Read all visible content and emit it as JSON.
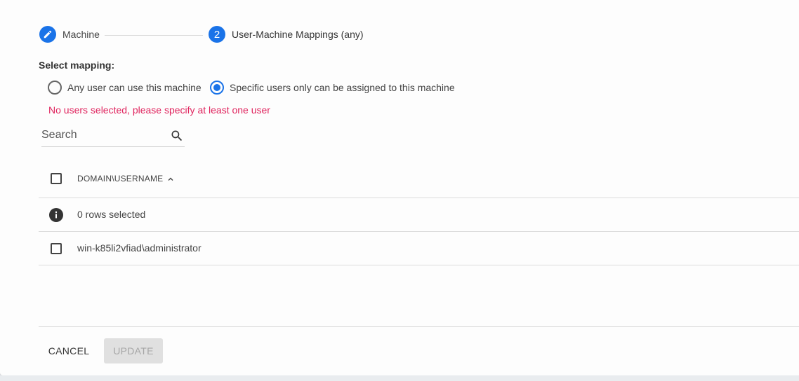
{
  "stepper": {
    "steps": [
      {
        "label": "Machine",
        "icon": "pencil-icon",
        "state": "completed"
      },
      {
        "label": "User-Machine Mappings (any)",
        "number": "2",
        "state": "active"
      }
    ]
  },
  "mapping": {
    "title": "Select mapping:",
    "options": [
      {
        "label": "Any user can use this machine",
        "selected": false
      },
      {
        "label": "Specific users only can be assigned to this machine",
        "selected": true
      }
    ],
    "error": "No users selected, please specify at least one user"
  },
  "search": {
    "placeholder": "Search",
    "value": ""
  },
  "table": {
    "columns": [
      {
        "label": "DOMAIN\\USERNAME",
        "sort": "ascending"
      }
    ],
    "selection_info": "0 rows selected",
    "rows": [
      {
        "username": "win-k85li2vfiad\\administrator",
        "checked": false
      }
    ]
  },
  "actions": {
    "cancel_label": "CANCEL",
    "update_label": "UPDATE",
    "update_enabled": false
  },
  "colors": {
    "accent": "#1a73e8",
    "error": "#e0245e",
    "disabled_bg": "#e0e0e0",
    "disabled_text": "#a6a6a6"
  }
}
